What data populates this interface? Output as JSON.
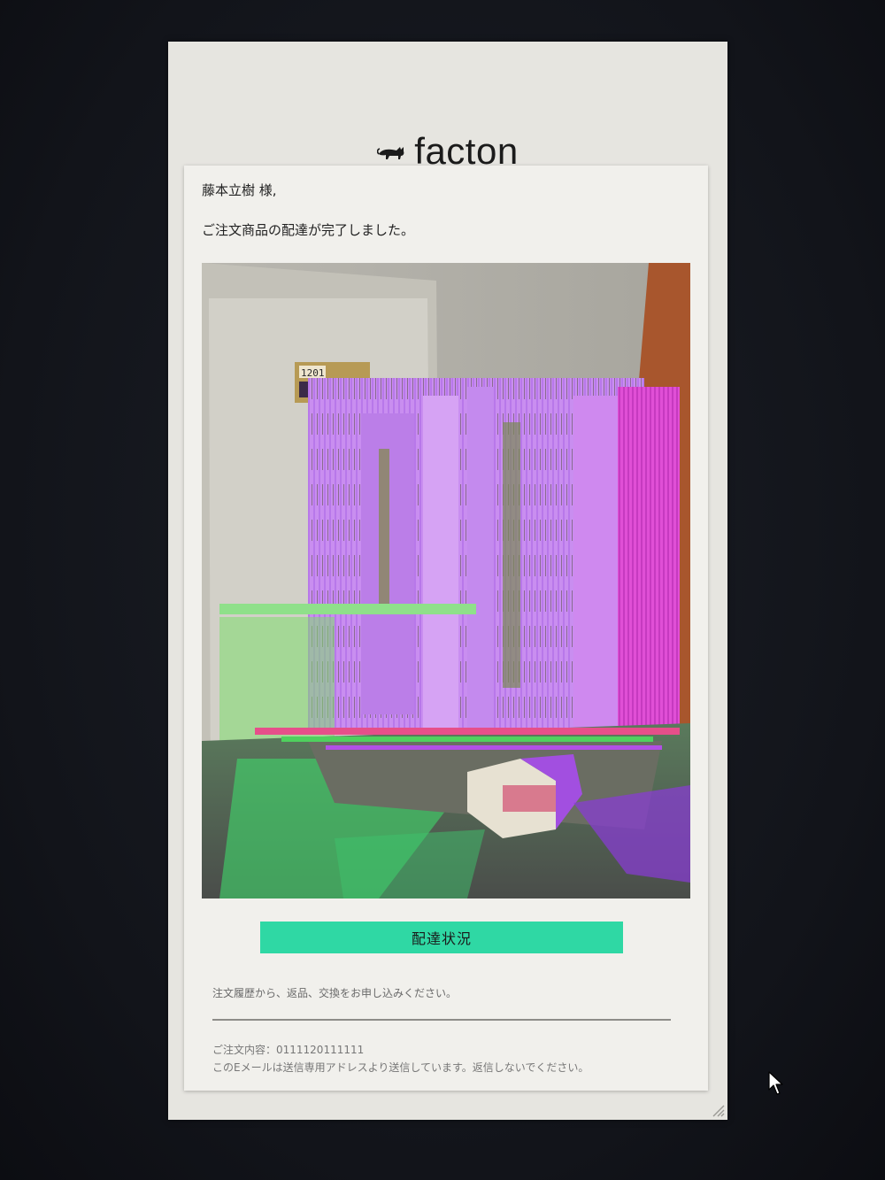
{
  "brand": {
    "name": "facton",
    "logo_icon": "cat-icon"
  },
  "email": {
    "greeting": "藤本立樹 様,",
    "message": "ご注文商品の配達が完了しました。",
    "photo_door_number": "1201",
    "cta_label": "配達状況",
    "returns_note": "注文履歴から、返品、交換をお申し込みください。",
    "order_line": "ご注文内容：0111120111111",
    "footer_note": "このEメールは送信専用アドレスより送信しています。返信しないでください。"
  },
  "colors": {
    "cta": "#2fd8a4",
    "window_bg": "#e6e5e0",
    "card_bg": "#f1f0ec",
    "screen_bg": "#16181f"
  },
  "icons": {
    "cursor": "mouse-pointer-icon",
    "resize": "resize-grip-icon"
  }
}
